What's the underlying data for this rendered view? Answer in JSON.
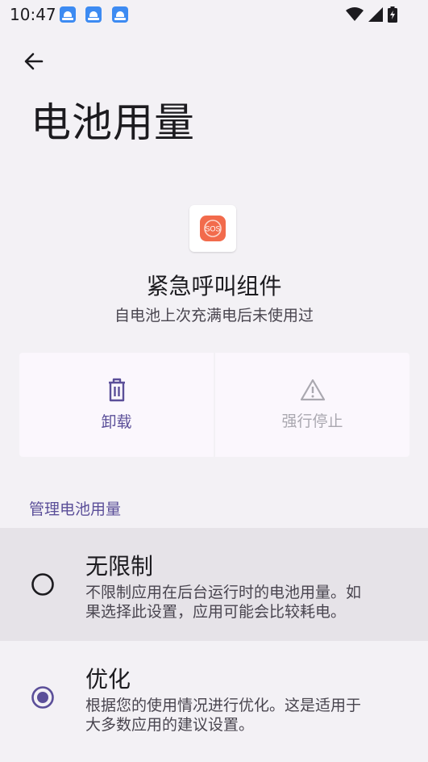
{
  "status": {
    "time": "10:47",
    "notification_icons": [
      "app-notification-icon",
      "app-notification-icon",
      "app-notification-icon"
    ]
  },
  "header": {
    "title": "电池用量"
  },
  "app": {
    "name": "紧急呼叫组件",
    "subtitle": "自电池上次充满电后未使用过",
    "icon_text": "SOS"
  },
  "actions": {
    "uninstall_label": "卸载",
    "force_stop_label": "强行停止"
  },
  "section": {
    "title": "管理电池用量"
  },
  "options": [
    {
      "title": "无限制",
      "desc_line1": "不限制应用在后台运行时的电池用量。如",
      "desc_line2": "果选择此设置，应用可能会比较耗电。",
      "selected": false
    },
    {
      "title": "优化",
      "desc_line1": "根据您的使用情况进行优化。这是适用于",
      "desc_line2": "大多数应用的建议设置。",
      "selected": true
    }
  ],
  "colors": {
    "accent": "#5b4f99",
    "background": "#f3f1f5",
    "selected_option_bg": "#e6e3e8",
    "sos_orange": "#f26b4c"
  }
}
